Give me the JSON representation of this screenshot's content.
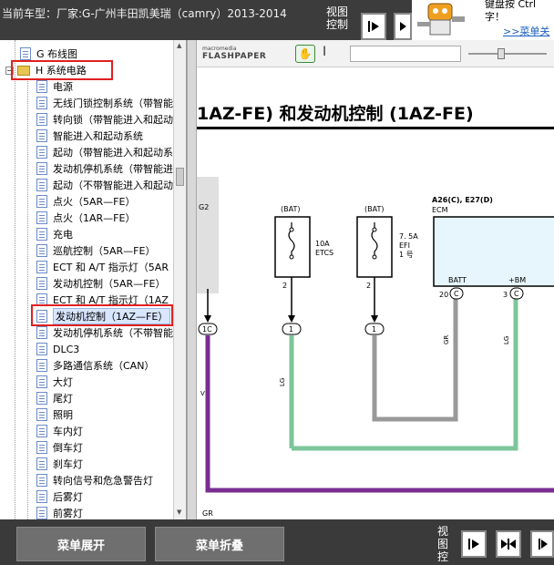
{
  "header": {
    "car_model": "当前车型：厂家:G-广州丰田凯美瑞（camry）2013-2014",
    "view_control_label": "视图控制"
  },
  "ad": {
    "line1": "键盘按  Ctrl",
    "line2": "字！",
    "link": ">>菜单关"
  },
  "tree": {
    "items": [
      {
        "label": "G 布线图",
        "type": "doc"
      },
      {
        "label": "H 系统电路",
        "type": "folder",
        "expander": "−"
      },
      {
        "label": "电源",
        "type": "doc"
      },
      {
        "label": "无线门锁控制系统（带智能",
        "type": "doc"
      },
      {
        "label": "转向锁（带智能进入和起动",
        "type": "doc"
      },
      {
        "label": "智能进入和起动系统",
        "type": "doc"
      },
      {
        "label": "起动（带智能进入和起动系",
        "type": "doc"
      },
      {
        "label": "发动机停机系统（带智能进",
        "type": "doc"
      },
      {
        "label": "起动（不带智能进入和起动",
        "type": "doc"
      },
      {
        "label": "点火（5AR—FE）",
        "type": "doc"
      },
      {
        "label": "点火（1AR—FE）",
        "type": "doc"
      },
      {
        "label": "充电",
        "type": "doc"
      },
      {
        "label": "巡航控制（5AR—FE）",
        "type": "doc"
      },
      {
        "label": "ECT 和 A/T 指示灯（5AR",
        "type": "doc"
      },
      {
        "label": "发动机控制（5AR—FE）",
        "type": "doc"
      },
      {
        "label": "ECT 和 A/T 指示灯（1AZ",
        "type": "doc"
      },
      {
        "label": "发动机控制（1AZ—FE）",
        "type": "doc",
        "selected": true
      },
      {
        "label": "发动机停机系统（不带智能",
        "type": "doc"
      },
      {
        "label": "DLC3",
        "type": "doc"
      },
      {
        "label": "多路通信系统（CAN）",
        "type": "doc"
      },
      {
        "label": "大灯",
        "type": "doc"
      },
      {
        "label": "尾灯",
        "type": "doc"
      },
      {
        "label": "照明",
        "type": "doc"
      },
      {
        "label": "车内灯",
        "type": "doc"
      },
      {
        "label": "倒车灯",
        "type": "doc"
      },
      {
        "label": "刹车灯",
        "type": "doc"
      },
      {
        "label": "转向信号和危急警告灯",
        "type": "doc"
      },
      {
        "label": "后雾灯",
        "type": "doc"
      },
      {
        "label": "前雾灯",
        "type": "doc"
      }
    ]
  },
  "viewer": {
    "logo_top": "macromedia",
    "logo_main": "FLASHPAPER",
    "search_value": "",
    "doc_title": "1AZ-FE) 和发动机控制 (1AZ-FE)",
    "diagram": {
      "g2": "G2",
      "conn_1c": "1C",
      "v_label": "V",
      "gr_bottom": "GR",
      "bat1": "(BAT)",
      "bat2": "(BAT)",
      "fuse1_line1": "10A",
      "fuse1_line2": "ETCS",
      "fuse2_line1": "7. 5A",
      "fuse2_line2": "EFI",
      "fuse2_line3": "1 号",
      "pin1": "2",
      "pin2": "2",
      "node1": "1",
      "node2": "1",
      "lg1": "LG",
      "ecm_code": "A26(C), E27(D)",
      "ecm_name": "ECM",
      "batt": "BATT",
      "bm": "+BM",
      "pin_20": "20",
      "pin_3": "3",
      "c1": "C",
      "c2": "C",
      "gr_wire": "GR",
      "lg_wire": "LG"
    }
  },
  "footer": {
    "expand_label": "菜单展开",
    "collapse_label": "菜单折叠",
    "view_control_label": "视图控"
  }
}
